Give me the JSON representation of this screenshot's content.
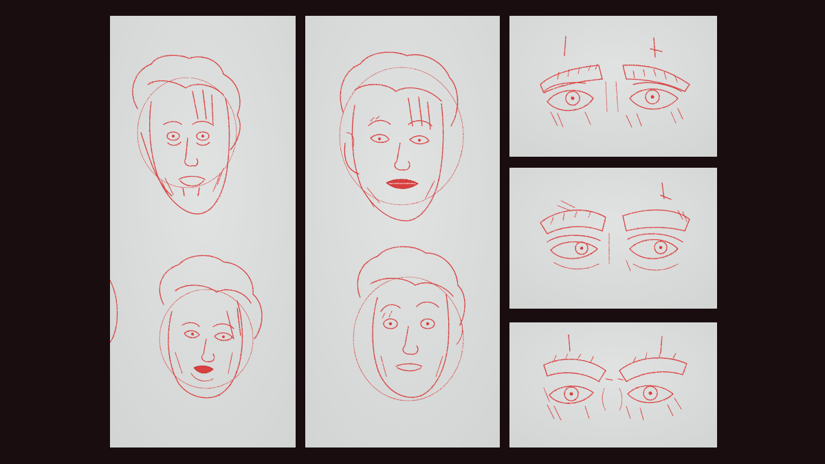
{
  "colors": {
    "background": "#1a0d0f",
    "paper": "#dcdedd",
    "paper_shade": "#cfd2d1",
    "pencil": "#d9403f",
    "pencil_dark": "#c2302f"
  },
  "panels": [
    {
      "name": "panel-left-faces",
      "content": [
        "face-sketch-worried",
        "face-sketch-pursed-lips"
      ]
    },
    {
      "name": "panel-middle-faces",
      "content": [
        "face-sketch-grimace",
        "face-sketch-surprised"
      ]
    },
    {
      "name": "panel-eyes-top",
      "content": [
        "eyes-sketch-wide"
      ]
    },
    {
      "name": "panel-eyes-middle",
      "content": [
        "eyes-sketch-sideways"
      ]
    },
    {
      "name": "panel-eyes-bottom",
      "content": [
        "eyes-sketch-angry"
      ]
    }
  ]
}
